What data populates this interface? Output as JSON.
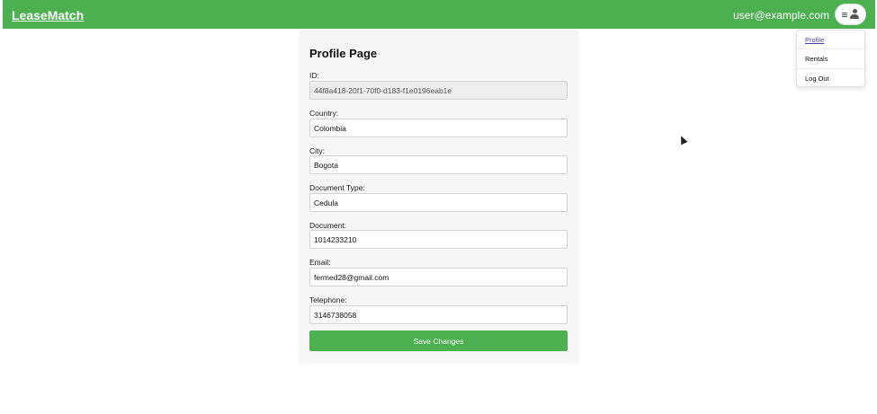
{
  "header": {
    "brand": "LeaseMatch",
    "user_email": "user@example.com",
    "user_button_icons": [
      "menu-icon",
      "person-icon"
    ]
  },
  "user_menu": {
    "items": [
      {
        "label": "Profile",
        "active": true
      },
      {
        "label": "Rentals",
        "active": false
      },
      {
        "label": "Log Out",
        "active": false
      }
    ]
  },
  "profile": {
    "title": "Profile Page",
    "fields": [
      {
        "label": "ID:",
        "value": "44f8a418-20f1-70f0-d183-f1e0196eab1e",
        "readonly": true
      },
      {
        "label": "Country:",
        "value": "Colombia",
        "readonly": false
      },
      {
        "label": "City:",
        "value": "Bogota",
        "readonly": false
      },
      {
        "label": "Document Type:",
        "value": "Cedula",
        "readonly": false
      },
      {
        "label": "Document:",
        "value": "1014233210",
        "readonly": false
      },
      {
        "label": "Email:",
        "value": "fermed28@gmail.com",
        "readonly": false
      },
      {
        "label": "Telephone:",
        "value": "3146738058",
        "readonly": false
      }
    ],
    "save_label": "Save Changes"
  },
  "colors": {
    "accent": "#4caf50",
    "active_link": "#4b3fa8"
  }
}
